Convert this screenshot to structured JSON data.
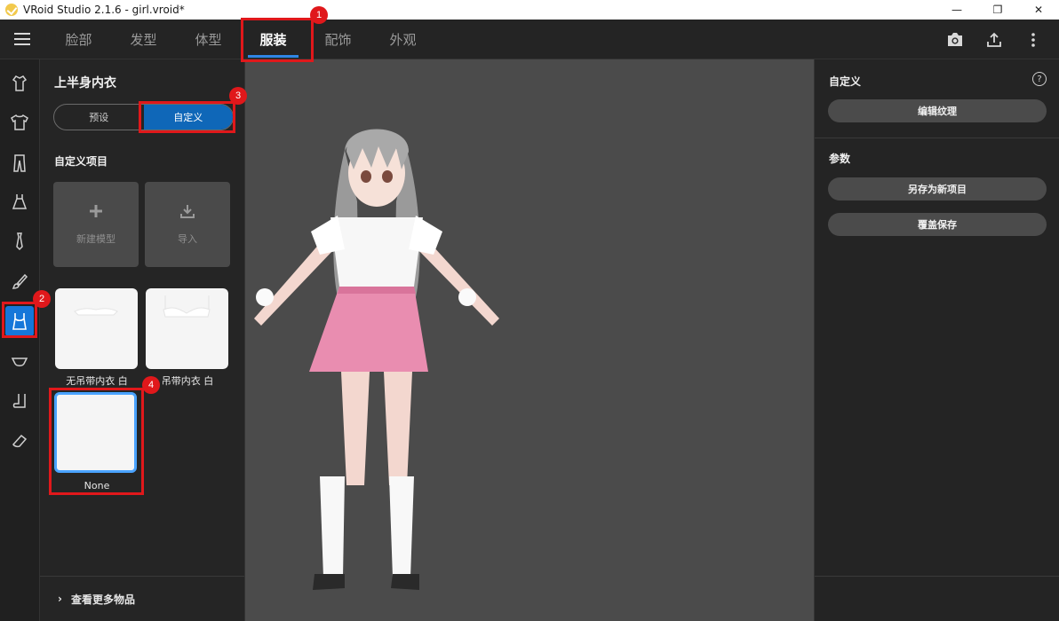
{
  "window": {
    "title": "VRoid Studio 2.1.6 - girl.vroid*",
    "controls": [
      "—",
      "❐",
      "✕"
    ]
  },
  "tabs": [
    {
      "label": "脸部",
      "active": false
    },
    {
      "label": "发型",
      "active": false
    },
    {
      "label": "体型",
      "active": false
    },
    {
      "label": "服装",
      "active": true
    },
    {
      "label": "配饰",
      "active": false
    },
    {
      "label": "外观",
      "active": false
    }
  ],
  "top_icons": [
    "camera-icon",
    "export-icon",
    "more-vertical-icon"
  ],
  "categories": [
    "shirt-outline-icon",
    "tshirt-icon",
    "pants-icon",
    "dress-icon",
    "tie-icon",
    "brush-icon",
    "underwear-top-icon",
    "underwear-bottom-icon",
    "sock-icon",
    "shoe-icon"
  ],
  "left_panel": {
    "title": "上半身内衣",
    "segments": {
      "preset": "预设",
      "custom": "自定义"
    },
    "section_label": "自定义项目",
    "actions": {
      "new_model": "新建模型",
      "import": "导入"
    },
    "items": [
      {
        "label": "无吊带内衣 白"
      },
      {
        "label": "吊带内衣 白"
      },
      {
        "label": "None"
      }
    ],
    "more": "查看更多物品"
  },
  "right_panel": {
    "custom_label": "自定义",
    "edit_texture": "编辑纹理",
    "params_label": "参数",
    "save_as_new": "另存为新项目",
    "overwrite_save": "覆盖保存"
  },
  "annotations": [
    "1",
    "2",
    "3",
    "4"
  ],
  "colors": {
    "accent": "#1677d9",
    "highlight": "#e0181b",
    "viewport_bg": "#4b4b4b"
  }
}
